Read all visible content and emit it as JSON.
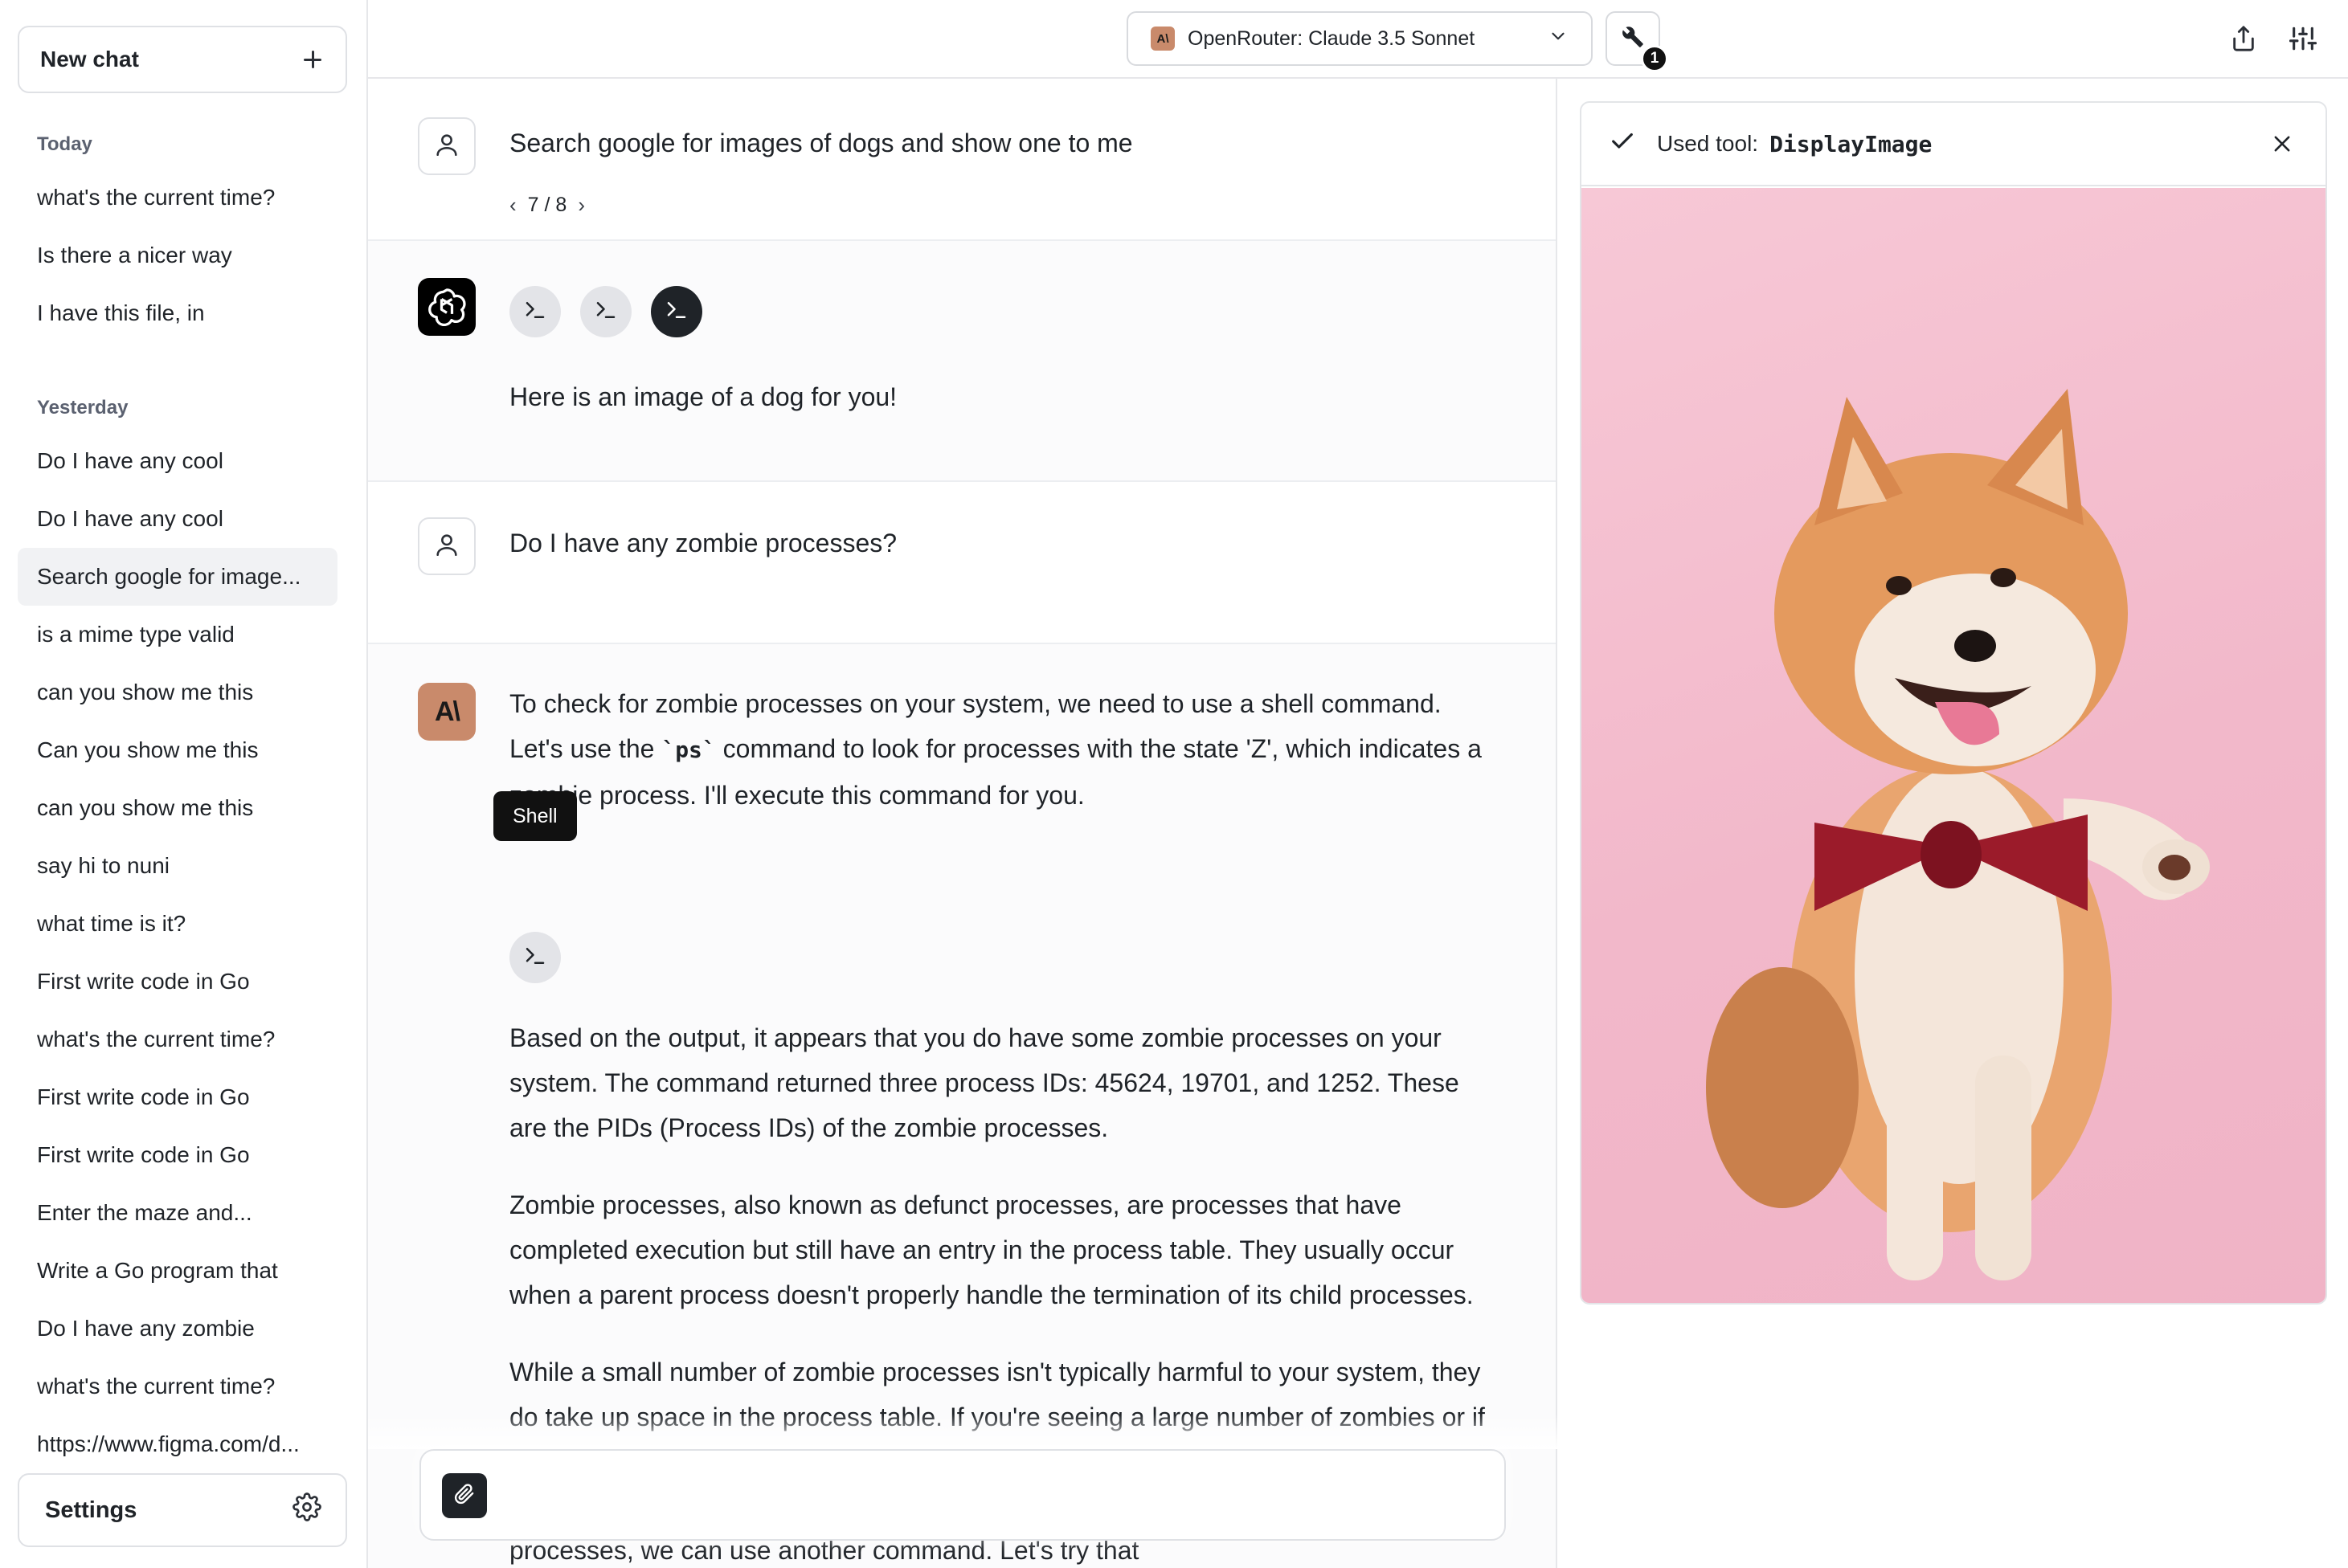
{
  "sidebar": {
    "new_chat_label": "New chat",
    "groups": [
      {
        "label": "Today",
        "items": [
          "what's the current time?",
          "Is there a nicer way",
          "I have this file, in"
        ]
      },
      {
        "label": "Yesterday",
        "items": [
          "Do I have any cool",
          "Do I have any cool",
          "Search google for image...",
          "is a mime type valid",
          "can you show me this",
          "Can you show me this",
          "can you show me this",
          "say hi to nuni",
          "what time is it?",
          "First write code in Go",
          "what's the current time?",
          "First write code in Go",
          "First write code in Go",
          "Enter the maze and...",
          "Write a Go program that",
          "Do I have any zombie",
          "what's the current time?",
          "https://www.figma.com/d..."
        ]
      }
    ],
    "active_item": "Search google for image...",
    "settings_label": "Settings"
  },
  "topbar": {
    "model_badge": "A\\",
    "model_label": "OpenRouter: Claude 3.5 Sonnet",
    "tool_count": "1"
  },
  "messages": {
    "m1": {
      "text": "Search google for images of dogs and show one to me",
      "pager": "7 / 8"
    },
    "m2": {
      "text": "Here is an image of a dog for you!"
    },
    "m3": {
      "text": "Do I have any zombie processes?"
    },
    "m4": {
      "badge": "A\\",
      "p1_a": "To check for zombie processes on your system, we need to use a shell command. Let's use the ",
      "p1_code": "`ps`",
      "p1_b": " command to look for processes with the state 'Z', which indicates a zombie process. I'll execute this command for you.",
      "tooltip": "Shell",
      "p2": "Based on the output, it appears that you do have some zombie processes on your system. The command returned three process IDs: 45624, 19701, and 1252. These are the PIDs (Process IDs) of the zombie processes.",
      "p3": "Zombie processes, also known as defunct processes, are processes that have completed execution but still have an entry in the process table. They usually occur when a parent process doesn't properly handle the termination of its child processes.",
      "p4": "While a small number of zombie processes isn't typically harmful to your system, they do take up space in the process table. If you're seeing a large number of zombies or if they're persisting for a long time, it might indicate a problem with the parent process that's not cleaning up its child processes properly.",
      "p5": "processes, we can use another command. Let's try that"
    }
  },
  "tool_panel": {
    "used_label": "Used tool:",
    "tool_name": "DisplayImage",
    "image_subject": "shiba inu dog with red bow tie on pink background"
  },
  "colors": {
    "anthropic_brand": "#c98a6b",
    "pink_background": "#f4bfcf",
    "dark": "#1f2328"
  }
}
